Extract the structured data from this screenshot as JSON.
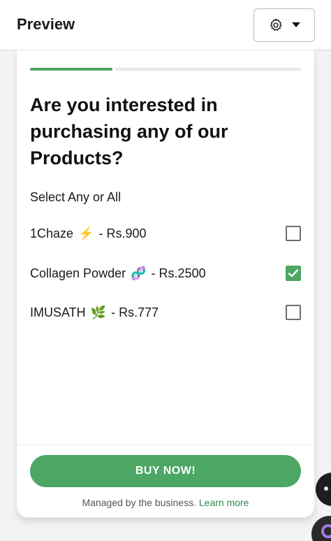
{
  "header": {
    "title": "Preview",
    "settings_icon": "gear-icon",
    "dropdown_icon": "caret-down-icon"
  },
  "form": {
    "progress": {
      "current_step": 1,
      "total_steps": 3,
      "fraction_complete": 0.3
    },
    "question": "Are you interested in purchasing any of our Products?",
    "subtitle": "Select Any or All",
    "options": [
      {
        "name": "1Chaze",
        "emoji": "⚡",
        "price": "- Rs.900",
        "checked": false
      },
      {
        "name": "Collagen Powder",
        "emoji": "🧬",
        "price": "- Rs.2500",
        "checked": true
      },
      {
        "name": "IMUSATH",
        "emoji": "🌿",
        "price": "- Rs.777",
        "checked": false
      }
    ],
    "cta_label": "BUY NOW!",
    "managed_text": "Managed by the business.",
    "learn_more": "Learn more"
  },
  "colors": {
    "accent": "#4ca764",
    "link": "#2e8a4c"
  }
}
